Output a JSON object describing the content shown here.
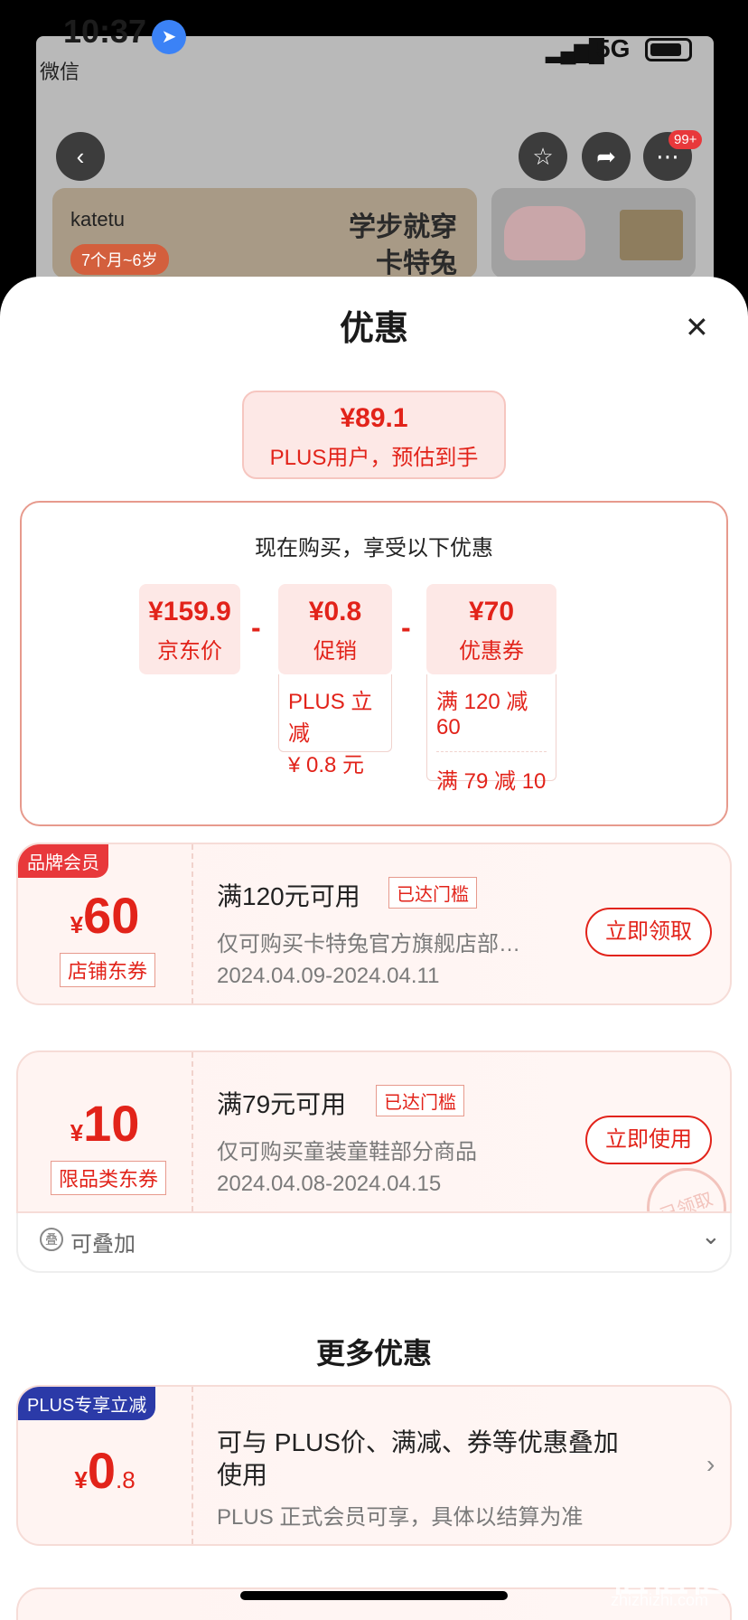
{
  "status_bar": {
    "time": "10:37",
    "back_app": "微信",
    "network": "5G"
  },
  "header": {
    "badge": "99+"
  },
  "banner": {
    "brand": "katetu",
    "age": "7个月~6岁",
    "slogan_line1": "学步就穿",
    "slogan_line2": "卡特兔"
  },
  "sheet": {
    "title": "优惠"
  },
  "estimate": {
    "price": "¥89.1",
    "label": "PLUS用户，预估到手"
  },
  "calc": {
    "heading": "现在购买，享受以下优惠",
    "items": [
      {
        "value": "¥159.9",
        "label": "京东价"
      },
      {
        "value": "¥0.8",
        "label": "促销"
      },
      {
        "value": "¥70",
        "label": "优惠券"
      }
    ],
    "minus": "-",
    "promo_detail": [
      "PLUS 立减",
      "¥ 0.8 元"
    ],
    "coupon_details": [
      "满 120 减 60",
      "满 79 减 10"
    ]
  },
  "coupons": [
    {
      "ribbon": "品牌会员",
      "yen": "¥",
      "amount": "60",
      "type": "店铺东券",
      "title": "满120元可用",
      "tag": "已达门槛",
      "desc": "仅可购买卡特兔官方旗舰店部…",
      "date": "2024.04.09-2024.04.11",
      "button": "立即领取"
    },
    {
      "ribbon": "",
      "yen": "¥",
      "amount": "10",
      "type": "限品类东券",
      "title": "满79元可用",
      "tag": "已达门槛",
      "desc": "仅可购买童装童鞋部分商品",
      "date": "2024.04.08-2024.04.15",
      "button": "立即使用",
      "stamp": "已领取"
    }
  ],
  "stackable": {
    "icon": "叠",
    "text": "可叠加"
  },
  "more": {
    "title": "更多优惠",
    "item": {
      "ribbon": "PLUS专享立减",
      "yen": "¥",
      "amount": "0",
      "decimal": ".8",
      "line1": "可与 PLUS价、满减、券等优惠叠加",
      "line2": "使用",
      "note": "PLUS 正式会员可享，具体以结算为准"
    }
  },
  "watermark": {
    "main": "值值值",
    "sub": "zhizhizhi.com"
  },
  "colors": {
    "accent": "#e2231a",
    "plus_blue": "#2b3aa8"
  }
}
